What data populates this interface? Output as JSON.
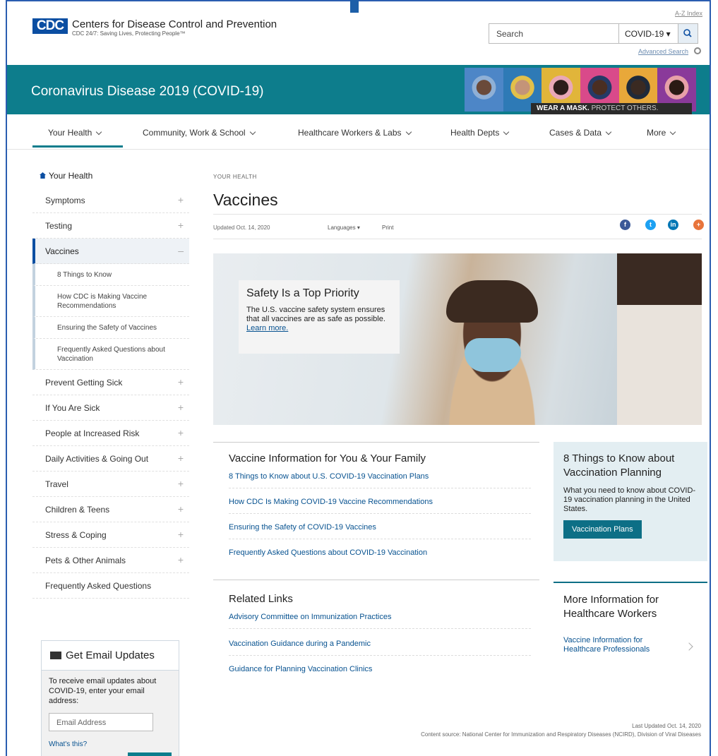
{
  "header": {
    "logo_text": "CDC",
    "org_name": "Centers for Disease Control and Prevention",
    "tagline": "CDC 24/7: Saving Lives, Protecting People™",
    "az_index": "A-Z Index",
    "search_placeholder": "Search",
    "search_scope": "COVID-19 ▾",
    "advanced_search": "Advanced Search"
  },
  "banner": {
    "title": "Coronavirus Disease 2019 (COVID-19)",
    "caption_bold": "WEAR A MASK.",
    "caption_rest": " PROTECT OTHERS."
  },
  "nav": {
    "items": [
      {
        "label": "Your Health"
      },
      {
        "label": "Community, Work & School"
      },
      {
        "label": "Healthcare Workers & Labs"
      },
      {
        "label": "Health Depts"
      },
      {
        "label": "Cases & Data"
      },
      {
        "label": "More"
      }
    ]
  },
  "sidebar": {
    "home": "Your Health",
    "items": [
      {
        "label": "Symptoms",
        "icon": "+"
      },
      {
        "label": "Testing",
        "icon": "+"
      },
      {
        "label": "Vaccines",
        "icon": "–"
      },
      {
        "label": "8 Things to Know"
      },
      {
        "label": "How CDC is Making Vaccine Recommendations"
      },
      {
        "label": "Ensuring the Safety of Vaccines"
      },
      {
        "label": "Frequently Asked Questions about Vaccination"
      },
      {
        "label": "Prevent Getting Sick",
        "icon": "+"
      },
      {
        "label": "If You Are Sick",
        "icon": "+"
      },
      {
        "label": "People at Increased Risk",
        "icon": "+"
      },
      {
        "label": "Daily Activities & Going Out",
        "icon": "+"
      },
      {
        "label": "Travel",
        "icon": "+"
      },
      {
        "label": "Children & Teens",
        "icon": "+"
      },
      {
        "label": "Stress & Coping",
        "icon": "+"
      },
      {
        "label": "Pets & Other Animals",
        "icon": "+"
      },
      {
        "label": "Frequently Asked Questions"
      }
    ]
  },
  "email": {
    "title": "Get Email Updates",
    "text": "To receive email updates about COVID-19, enter your email address:",
    "placeholder": "Email Address",
    "what": "What's this?"
  },
  "main": {
    "breadcrumb": "YOUR HEALTH",
    "title": "Vaccines",
    "updated": "Updated Oct. 14, 2020",
    "languages": "Languages ▾",
    "print": "Print",
    "hero": {
      "heading": "Safety Is a Top Priority",
      "text": "The U.S. vaccine safety system ensures that all vaccines are as safe as possible. ",
      "link": "Learn more."
    },
    "info_card": {
      "title": "Vaccine Information for You & Your Family",
      "links": [
        "8 Things to Know about U.S. COVID-19 Vaccination Plans",
        "How CDC Is Making COVID-19 Vaccine Recommendations",
        "Ensuring the Safety of COVID-19 Vaccines",
        "Frequently Asked Questions about COVID-19 Vaccination"
      ]
    },
    "side_card": {
      "title": "8 Things to Know about Vaccination Planning",
      "text": "What you need to know about COVID-19 vaccination planning in the United States.",
      "button": "Vaccination Plans"
    },
    "related": {
      "title": "Related Links",
      "links": [
        "Advisory Committee on Immunization Practices",
        "Vaccination Guidance during a Pandemic",
        "Guidance for Planning Vaccination Clinics"
      ]
    },
    "more_info": {
      "title": "More Information for Healthcare Workers",
      "link": "Vaccine Information for Healthcare Professionals"
    },
    "footer": {
      "last_updated": "Last Updated Oct. 14, 2020",
      "source": "Content source: National Center for Immunization and Respiratory Diseases (NCIRD), Division of Viral Diseases"
    }
  },
  "colors": {
    "teal": "#0d7d8c",
    "cdc_blue": "#0b4ea2",
    "link": "#075290"
  }
}
